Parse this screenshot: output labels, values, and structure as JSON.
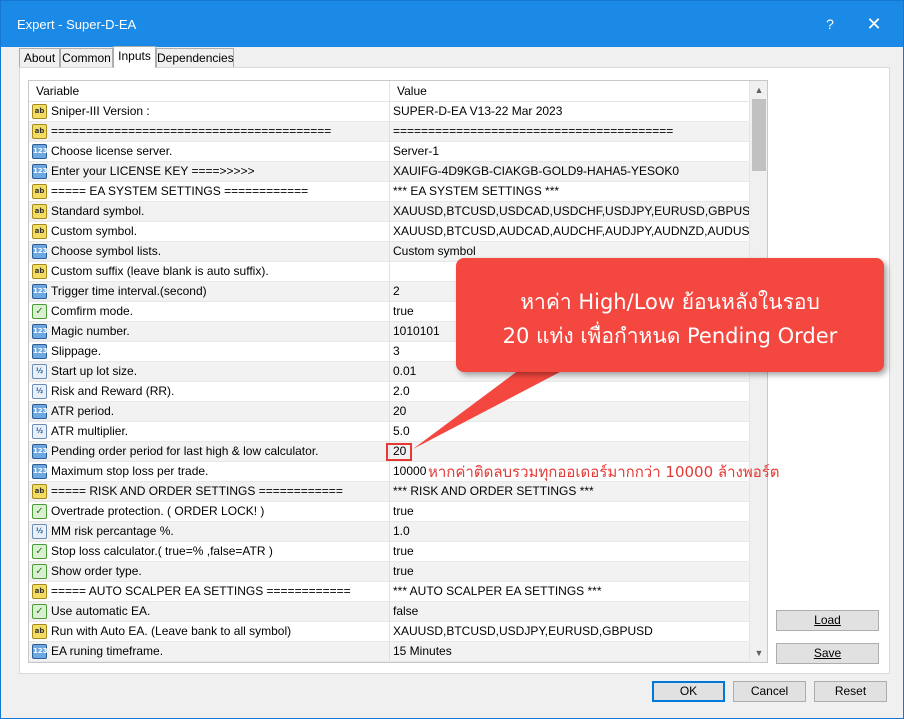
{
  "window": {
    "title": "Expert - Super-D-EA",
    "help_glyph": "?",
    "close_glyph": "✕",
    "accent": "#1b8ae6"
  },
  "tabs": [
    {
      "label": "About"
    },
    {
      "label": "Common"
    },
    {
      "label": "Inputs",
      "active": true
    },
    {
      "label": "Dependencies"
    }
  ],
  "table": {
    "col_variable": "Variable",
    "col_value": "Value",
    "rows": [
      {
        "type": "str",
        "variable": "Sniper-III Version :",
        "value": "SUPER-D-EA V13-22 Mar 2023"
      },
      {
        "type": "str",
        "variable": "========================================",
        "value": "========================================"
      },
      {
        "type": "int",
        "variable": "Choose license server.",
        "value": "Server-1"
      },
      {
        "type": "int",
        "variable": "Enter your LICENSE KEY ====>>>>>",
        "value": "XAUIFG-4D9KGB-CIAKGB-GOLD9-HAHA5-YESOK0"
      },
      {
        "type": "str",
        "variable": "===== EA SYSTEM SETTINGS ============",
        "value": "*** EA SYSTEM SETTINGS ***"
      },
      {
        "type": "str",
        "variable": "Standard symbol.",
        "value": "XAUUSD,BTCUSD,USDCAD,USDCHF,USDJPY,EURUSD,GBPUSD,N..."
      },
      {
        "type": "str",
        "variable": "Custom symbol.",
        "value": "XAUUSD,BTCUSD,AUDCAD,AUDCHF,AUDJPY,AUDNZD,AUDUSD,C..."
      },
      {
        "type": "int",
        "variable": "Choose symbol lists.",
        "value": "Custom symbol"
      },
      {
        "type": "str",
        "variable": "Custom suffix (leave blank is auto suffix).",
        "value": ""
      },
      {
        "type": "int",
        "variable": "Trigger time interval.(second)",
        "value": "2"
      },
      {
        "type": "bool",
        "variable": "Comfirm mode.",
        "value": "true"
      },
      {
        "type": "int",
        "variable": "Magic number.",
        "value": "1010101"
      },
      {
        "type": "int",
        "variable": "Slippage.",
        "value": "3"
      },
      {
        "type": "dbl",
        "variable": "Start up lot size.",
        "value": "0.01"
      },
      {
        "type": "dbl",
        "variable": "Risk and Reward (RR).",
        "value": "2.0"
      },
      {
        "type": "int",
        "variable": "ATR period.",
        "value": "20"
      },
      {
        "type": "dbl",
        "variable": "ATR multiplier.",
        "value": "5.0"
      },
      {
        "type": "int",
        "variable": "Pending order period for last high & low calculator.",
        "value": "20",
        "highlight": true
      },
      {
        "type": "int",
        "variable": "Maximum stop loss per trade.",
        "value": "10000"
      },
      {
        "type": "str",
        "variable": "===== RISK AND ORDER SETTINGS ============",
        "value": "*** RISK AND ORDER SETTINGS ***"
      },
      {
        "type": "bool",
        "variable": "Overtrade protection. ( ORDER LOCK! )",
        "value": "true"
      },
      {
        "type": "dbl",
        "variable": "MM risk percantage %.",
        "value": "1.0"
      },
      {
        "type": "bool",
        "variable": "Stop loss calculator.( true=% ,false=ATR )",
        "value": "true"
      },
      {
        "type": "bool",
        "variable": "Show order type.",
        "value": "true"
      },
      {
        "type": "str",
        "variable": "===== AUTO SCALPER EA SETTINGS ============",
        "value": "*** AUTO SCALPER EA SETTINGS ***"
      },
      {
        "type": "bool",
        "variable": "Use automatic EA.",
        "value": "false"
      },
      {
        "type": "str",
        "variable": "Run with Auto EA. (Leave bank to all symbol)",
        "value": "XAUUSD,BTCUSD,USDJPY,EURUSD,GBPUSD"
      },
      {
        "type": "int",
        "variable": "EA runing timeframe.",
        "value": "15 Minutes"
      }
    ]
  },
  "icons": {
    "str": "ab",
    "int": "123",
    "dbl": "½",
    "bool": "✓",
    "scroll_up": "▲",
    "scroll_down": "▼"
  },
  "buttons": {
    "load": "Load",
    "save": "Save",
    "ok": "OK",
    "cancel": "Cancel",
    "reset": "Reset"
  },
  "callout": {
    "line1": "หาค่า High/Low ย้อนหลังในรอบ",
    "line2": "20 แท่ง เพื่อกำหนด Pending Order",
    "color": "#f4473f"
  },
  "annotation": {
    "text": "หากค่าติดลบรวมทุกออเดอร์มากกว่า 10000 ล้างพอร์ต",
    "color": "#e53935"
  }
}
